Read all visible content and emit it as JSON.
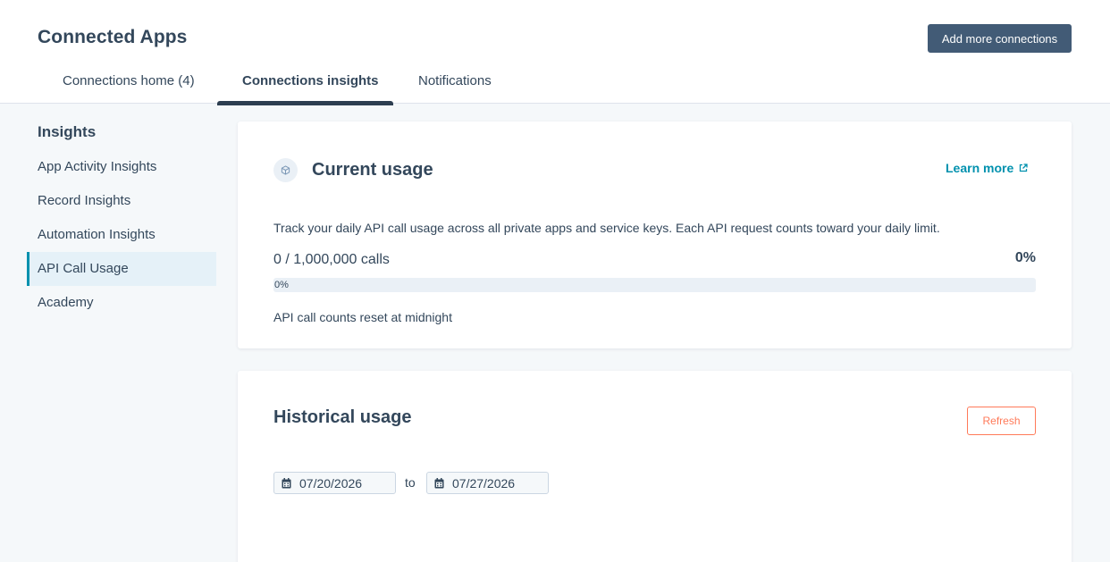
{
  "header": {
    "title": "Connected Apps",
    "add_button": "Add more connections"
  },
  "tabs": [
    {
      "label": "Connections home (4)",
      "active": false
    },
    {
      "label": "Connections insights",
      "active": true
    },
    {
      "label": "Notifications",
      "active": false
    }
  ],
  "sidebar": {
    "heading": "Insights",
    "items": [
      {
        "label": "App Activity Insights",
        "active": false
      },
      {
        "label": "Record Insights",
        "active": false
      },
      {
        "label": "Automation Insights",
        "active": false
      },
      {
        "label": "API Call Usage",
        "active": true
      },
      {
        "label": "Academy",
        "active": false
      }
    ]
  },
  "current_usage": {
    "icon": "cube-icon",
    "title": "Current usage",
    "learn_more": "Learn more",
    "description": "Track your daily API call usage across all private apps and service keys. Each API request counts toward your daily limit.",
    "calls_text": "0 / 1,000,000 calls",
    "percent_text": "0%",
    "progress_label": "0%",
    "progress_fraction": 0,
    "reset_note": "API call counts reset at midnight"
  },
  "historical_usage": {
    "title": "Historical usage",
    "refresh_label": "Refresh",
    "date_from": "07/20/2026",
    "to_label": "to",
    "date_to": "07/27/2026"
  },
  "colors": {
    "accent": "#0091ae",
    "primary_button": "#425b76",
    "refresh": "#ff7a59",
    "text": "#33475b",
    "page_bg": "#f5f8fa"
  }
}
